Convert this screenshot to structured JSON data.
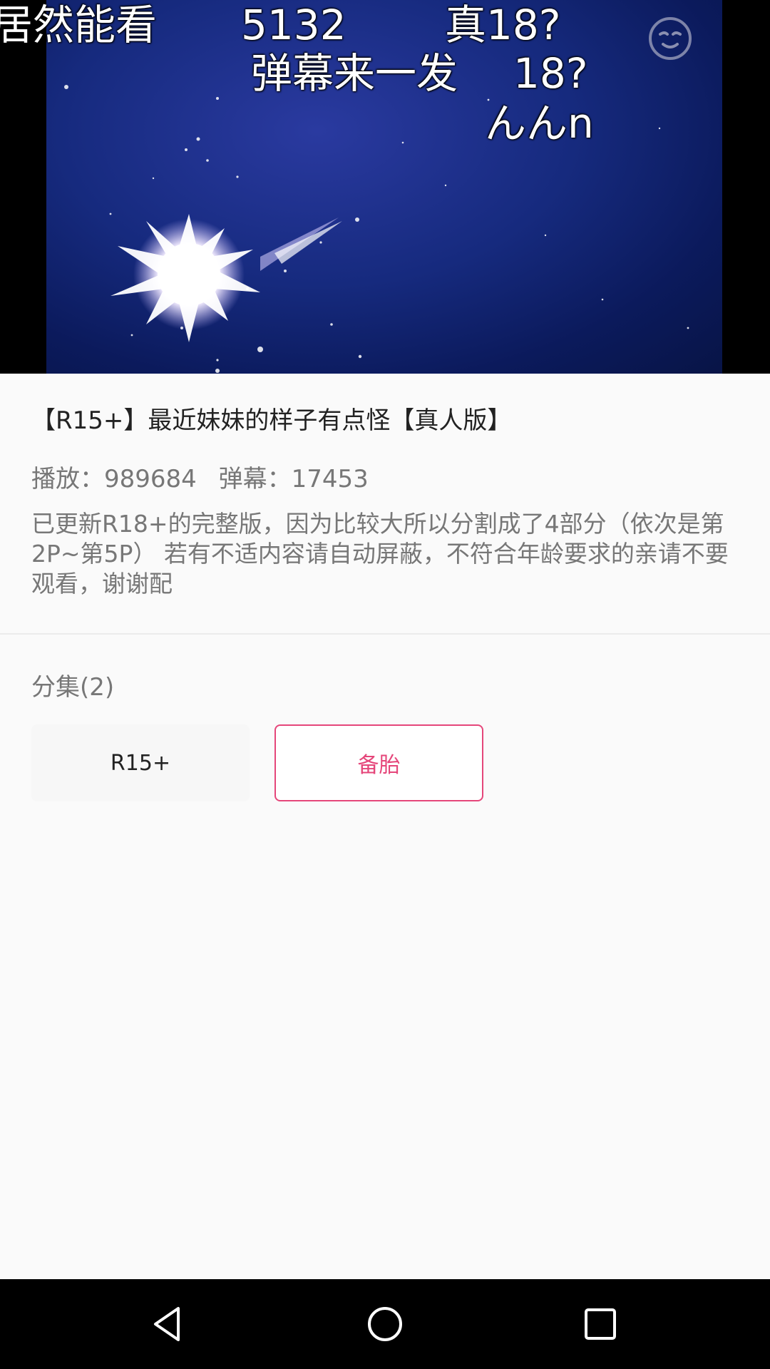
{
  "player": {
    "danmaku": [
      {
        "text": "居然能看"
      },
      {
        "text": "5132"
      },
      {
        "text": "真18?"
      },
      {
        "text": "弹幕来一发"
      },
      {
        "text": "18?"
      },
      {
        "text": "んんn"
      }
    ],
    "emoji_icon": "emoji-face-icon"
  },
  "video": {
    "title": "【R15+】最近妹妹的样子有点怪【真人版】",
    "plays_label": "播放：989684",
    "danmaku_label": "弹幕：17453",
    "description": "已更新R18+的完整版，因为比较大所以分割成了4部分（依次是第2P~第5P） 若有不适内容请自动屏蔽，不符合年龄要求的亲请不要观看，谢谢配"
  },
  "episodes": {
    "label": "分集(2)",
    "items": [
      {
        "label": "R15+"
      },
      {
        "label": "备胎"
      }
    ]
  },
  "colors": {
    "accent": "#e5467a",
    "background": "#fafafa",
    "text_primary": "#222222",
    "text_secondary": "#777777"
  },
  "navbar": {
    "icons": [
      "back-icon",
      "home-icon",
      "recents-icon"
    ]
  }
}
